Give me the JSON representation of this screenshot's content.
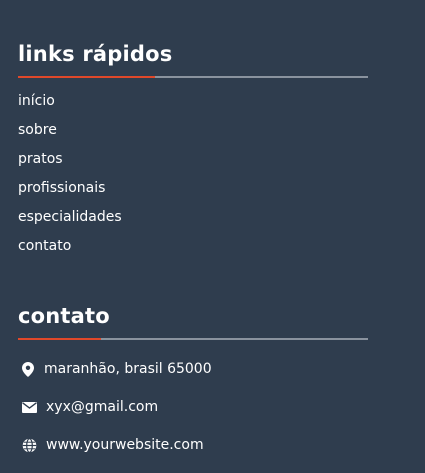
{
  "quick_links": {
    "title": "links rápidos",
    "items": [
      {
        "label": "início"
      },
      {
        "label": "sobre"
      },
      {
        "label": "pratos"
      },
      {
        "label": "profissionais"
      },
      {
        "label": "especialidades"
      },
      {
        "label": "contato"
      }
    ]
  },
  "contact": {
    "title": "contato",
    "address": {
      "icon": "map-pin-icon",
      "text": "maranhão, brasil 65000"
    },
    "email": {
      "icon": "envelope-icon",
      "text": "xyx@gmail.com"
    },
    "website": {
      "icon": "globe-icon",
      "text": "www.yourwebsite.com"
    }
  },
  "colors": {
    "background": "#2f3d4e",
    "accent": "#e0482a",
    "rule": "#8a939e",
    "text": "#ffffff"
  }
}
